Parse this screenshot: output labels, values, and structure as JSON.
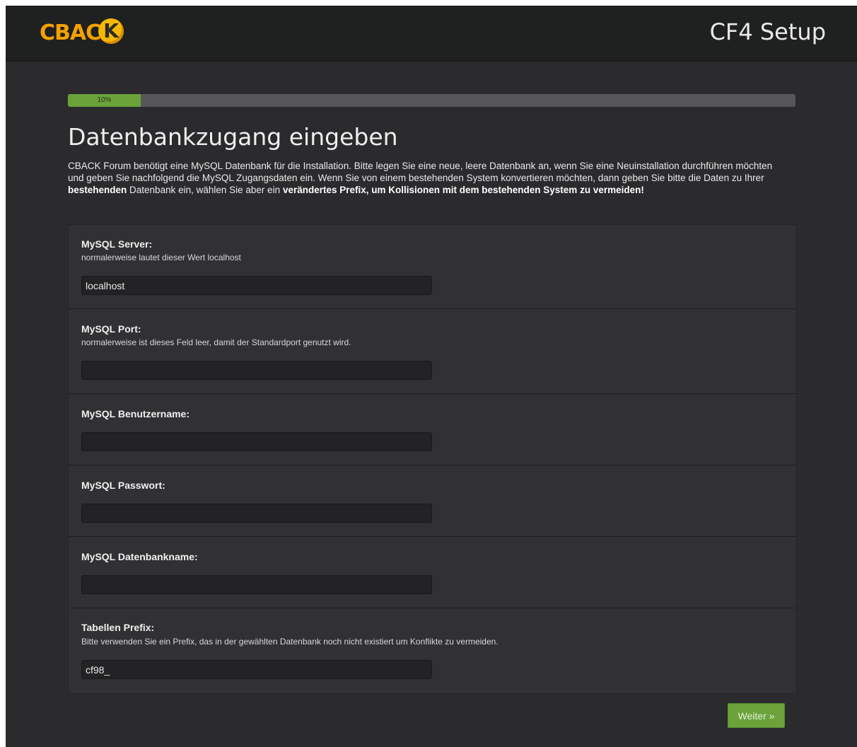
{
  "header": {
    "logo_text": "CBAC",
    "logo_badge": "K",
    "app_title": "CF4 Setup"
  },
  "progress": {
    "label": "10%",
    "value": 0.1
  },
  "page": {
    "title": "Datenbankzugang eingeben",
    "intro_1": "CBACK Forum benötigt eine MySQL Datenbank für die Installation. Bitte legen Sie eine neue, leere Datenbank an, wenn Sie eine Neuinstallation durchführen möchten und geben Sie nachfolgend die MySQL Zugangsdaten ein. Wenn Sie von einem bestehenden System konvertieren möchten, dann geben Sie bitte die Daten zu Ihrer ",
    "intro_bold_1": "bestehenden",
    "intro_2": " Datenbank ein, wählen Sie aber ein ",
    "intro_bold_2": "verändertes Prefix, um Kollisionen mit dem bestehenden System zu vermeiden!"
  },
  "form": {
    "server": {
      "label": "MySQL Server:",
      "hint": "normalerweise lautet dieser Wert localhost",
      "value": "localhost"
    },
    "port": {
      "label": "MySQL Port:",
      "hint": "normalerweise ist dieses Feld leer, damit der Standardport genutzt wird.",
      "value": ""
    },
    "username": {
      "label": "MySQL Benutzername:",
      "value": ""
    },
    "password": {
      "label": "MySQL Passwort:",
      "value": ""
    },
    "dbname": {
      "label": "MySQL Datenbankname:",
      "value": ""
    },
    "prefix": {
      "label": "Tabellen Prefix:",
      "hint": "Bitte verwenden Sie ein Prefix, das in der gewählten Datenbank noch nicht existiert um Konflikte zu vermeiden.",
      "value": "cf98_"
    }
  },
  "actions": {
    "next_label": "Weiter »"
  },
  "colors": {
    "accent_green": "#6ba33a",
    "logo_orange": "#f5a100",
    "background": "#2b2b2e"
  }
}
